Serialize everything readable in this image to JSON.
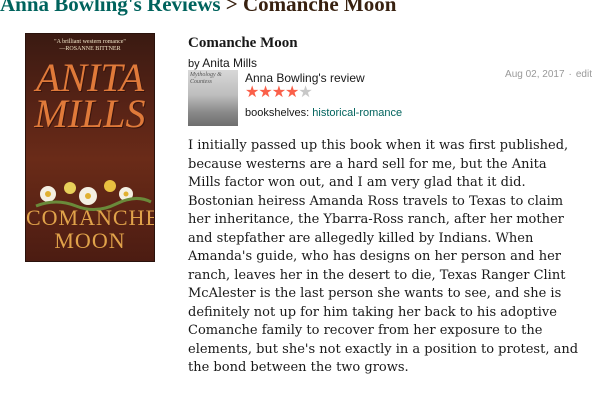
{
  "breadcrumb": {
    "parent": "Anna Bowling's Reviews",
    "separator": ">",
    "current": "Comanche Moon"
  },
  "cover": {
    "blurb_line1": "\"A brilliant western romance\"",
    "blurb_line2": "—ROSANNE BITTNER",
    "author_first": "ANITA",
    "author_last": "MILLS",
    "title_line1": "COMANCHE",
    "title_line2": "MOON"
  },
  "book": {
    "title": "Comanche Moon",
    "by_label": "by",
    "author": "Anita Mills"
  },
  "review": {
    "reviewer": "Anna Bowling's review",
    "avatar_caption": "Mythology & Countess",
    "rating": 4,
    "max_rating": 5,
    "date": "Aug 02, 2017",
    "separator": "·",
    "edit_label": "edit",
    "bookshelves_label": "bookshelves:",
    "shelf": "historical-romance",
    "text": "I initially passed up this book when it was first published, because westerns are a hard sell for me, but the Anita Mills factor won out, and I am very glad that it did. Bostonian heiress Amanda Ross travels to Texas to claim her inheritance, the Ybarra-Ross ranch, after her mother and stepfather are allegedly killed by Indians. When Amanda's guide, who has designs on her person and her ranch, leaves her in the desert to die, Texas Ranger Clint McAlester is the last person she wants to see, and she is definitely not up for him taking her back to his adoptive Comanche family to recover from her exposure to the elements, but she's not exactly in a position to protest, and the bond between the two grows."
  },
  "colors": {
    "link": "#00635d",
    "heading_brown": "#382110",
    "star_filled": "#fa604a",
    "star_empty": "#c8c8c8",
    "meta_gray": "#999999"
  }
}
